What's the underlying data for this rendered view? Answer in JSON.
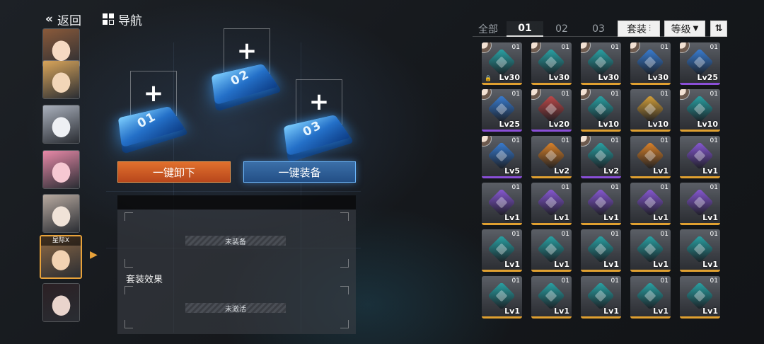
{
  "header": {
    "back_label": "返回",
    "nav_label": "导航",
    "back_icon": "double-chevron-left",
    "nav_icon": "grid"
  },
  "roster": [
    {
      "name": "character-1",
      "tag": ""
    },
    {
      "name": "character-2",
      "tag": ""
    },
    {
      "name": "character-3",
      "tag": ""
    },
    {
      "name": "character-4",
      "tag": ""
    },
    {
      "name": "character-5",
      "tag": ""
    },
    {
      "name": "character-6",
      "tag": "星际X",
      "selected": true
    },
    {
      "name": "character-7",
      "tag": ""
    }
  ],
  "slots": [
    {
      "num": "01"
    },
    {
      "num": "02"
    },
    {
      "num": "03"
    }
  ],
  "slot_plus": "+",
  "buttons": {
    "unequip_all": "一键卸下",
    "equip_all": "一键装备"
  },
  "equip_status": "未装备",
  "set_effect": {
    "title": "套装效果",
    "status": "未激活"
  },
  "tabs": [
    {
      "label": "全部"
    },
    {
      "label": "01",
      "active": true
    },
    {
      "label": "02"
    },
    {
      "label": "03"
    }
  ],
  "filters": {
    "set_label": "套装",
    "sort_label": "等级",
    "sort_icon": "caret-down",
    "order_icon": "sort-order"
  },
  "colors": {
    "orange": "#e1702d",
    "blue": "#3b6fa8",
    "purple": "#8a4fd8",
    "gold": "#e0a030",
    "teal": "#2aa6a8"
  },
  "cards": [
    {
      "lv": "Lv30",
      "cnt": "01",
      "rarity": "gold",
      "owner": true,
      "lock": true,
      "chip": "teal"
    },
    {
      "lv": "Lv30",
      "cnt": "01",
      "rarity": "gold",
      "owner": true,
      "chip": "teal"
    },
    {
      "lv": "Lv30",
      "cnt": "01",
      "rarity": "gold",
      "owner": true,
      "chip": "teal"
    },
    {
      "lv": "Lv30",
      "cnt": "01",
      "rarity": "gold",
      "owner": true,
      "chip": "blue"
    },
    {
      "lv": "Lv25",
      "cnt": "01",
      "rarity": "purple",
      "owner": true,
      "chip": "blue"
    },
    {
      "lv": "Lv25",
      "cnt": "01",
      "rarity": "purple",
      "owner": true,
      "chip": "blue"
    },
    {
      "lv": "Lv20",
      "cnt": "01",
      "rarity": "purple",
      "owner": true,
      "chip": "red"
    },
    {
      "lv": "Lv10",
      "cnt": "01",
      "rarity": "gold",
      "owner": true,
      "chip": "teal"
    },
    {
      "lv": "Lv10",
      "cnt": "01",
      "rarity": "gold",
      "owner": false,
      "chip": "gold"
    },
    {
      "lv": "Lv10",
      "cnt": "01",
      "rarity": "gold",
      "owner": true,
      "chip": "teal"
    },
    {
      "lv": "Lv5",
      "cnt": "01",
      "rarity": "purple",
      "owner": true,
      "chip": "blue"
    },
    {
      "lv": "Lv2",
      "cnt": "01",
      "rarity": "gold",
      "owner": false,
      "chip": "orange"
    },
    {
      "lv": "Lv2",
      "cnt": "01",
      "rarity": "purple",
      "owner": true,
      "chip": "teal"
    },
    {
      "lv": "Lv1",
      "cnt": "01",
      "rarity": "gold",
      "owner": false,
      "chip": "orange"
    },
    {
      "lv": "Lv1",
      "cnt": "01",
      "rarity": "gold",
      "owner": false,
      "chip": "purple"
    },
    {
      "lv": "Lv1",
      "cnt": "01",
      "rarity": "gold",
      "owner": false,
      "chip": "purple"
    },
    {
      "lv": "Lv1",
      "cnt": "01",
      "rarity": "gold",
      "owner": false,
      "chip": "purple"
    },
    {
      "lv": "Lv1",
      "cnt": "01",
      "rarity": "gold",
      "owner": false,
      "chip": "purple"
    },
    {
      "lv": "Lv1",
      "cnt": "01",
      "rarity": "gold",
      "owner": false,
      "chip": "purple"
    },
    {
      "lv": "Lv1",
      "cnt": "01",
      "rarity": "gold",
      "owner": false,
      "chip": "purple"
    },
    {
      "lv": "Lv1",
      "cnt": "01",
      "rarity": "gold",
      "owner": false,
      "chip": "teal"
    },
    {
      "lv": "Lv1",
      "cnt": "01",
      "rarity": "gold",
      "owner": false,
      "chip": "teal"
    },
    {
      "lv": "Lv1",
      "cnt": "01",
      "rarity": "gold",
      "owner": false,
      "chip": "teal"
    },
    {
      "lv": "Lv1",
      "cnt": "01",
      "rarity": "gold",
      "owner": false,
      "chip": "teal"
    },
    {
      "lv": "Lv1",
      "cnt": "01",
      "rarity": "gold",
      "owner": false,
      "chip": "teal"
    },
    {
      "lv": "Lv1",
      "cnt": "01",
      "rarity": "gold",
      "owner": false,
      "chip": "teal"
    },
    {
      "lv": "Lv1",
      "cnt": "01",
      "rarity": "gold",
      "owner": false,
      "chip": "teal"
    },
    {
      "lv": "Lv1",
      "cnt": "01",
      "rarity": "gold",
      "owner": false,
      "chip": "teal"
    },
    {
      "lv": "Lv1",
      "cnt": "01",
      "rarity": "gold",
      "owner": false,
      "chip": "teal"
    },
    {
      "lv": "Lv1",
      "cnt": "01",
      "rarity": "gold",
      "owner": false,
      "chip": "teal"
    }
  ]
}
